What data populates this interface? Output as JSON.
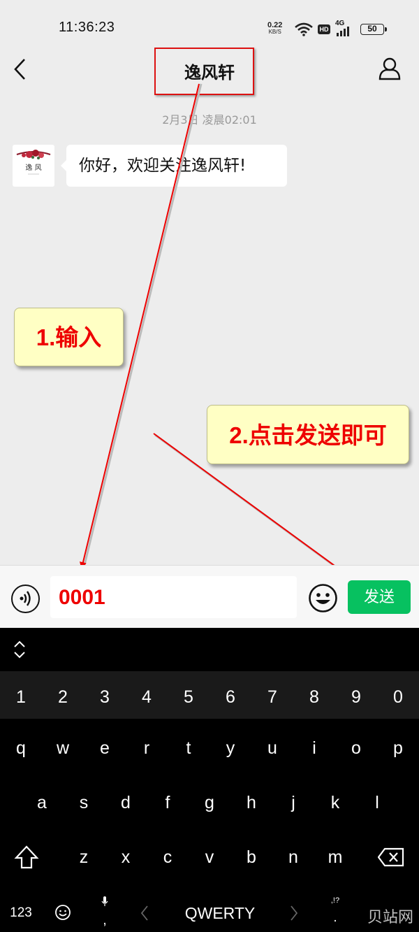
{
  "status_bar": {
    "time": "11:36:23",
    "net_speed_value": "0.22",
    "net_speed_unit": "KB/S",
    "hd_label": "HD",
    "signal_label": "4G",
    "battery": "50"
  },
  "header": {
    "title": "逸风轩",
    "back_icon": "chevron-left-icon",
    "profile_icon": "person-icon"
  },
  "chat": {
    "timestamp": "2月3日 凌晨02:01",
    "avatar_text": "逸 风",
    "message": "你好，欢迎关注逸风轩!"
  },
  "annotations": {
    "step1": "1.输入",
    "step2": "2.点击发送即可",
    "highlight_color": "#dd1111",
    "callout_bg": "#ffffc4"
  },
  "input_bar": {
    "voice_icon": "voice-icon",
    "text_value": "0001",
    "emoji_icon": "smile-icon",
    "send_label": "发送",
    "send_color": "#07c160"
  },
  "keyboard": {
    "numbers": [
      "1",
      "2",
      "3",
      "4",
      "5",
      "6",
      "7",
      "8",
      "9",
      "0"
    ],
    "row1": [
      "q",
      "w",
      "e",
      "r",
      "t",
      "y",
      "u",
      "i",
      "o",
      "p"
    ],
    "row2": [
      "a",
      "s",
      "d",
      "f",
      "g",
      "h",
      "j",
      "k",
      "l"
    ],
    "row3": [
      "z",
      "x",
      "c",
      "v",
      "b",
      "n",
      "m"
    ],
    "mode_label": "123",
    "layout_label": "QWERTY",
    "punct_label": ",!?",
    "dot_label": ".",
    "comma_label": ","
  },
  "watermark": "贝站网"
}
